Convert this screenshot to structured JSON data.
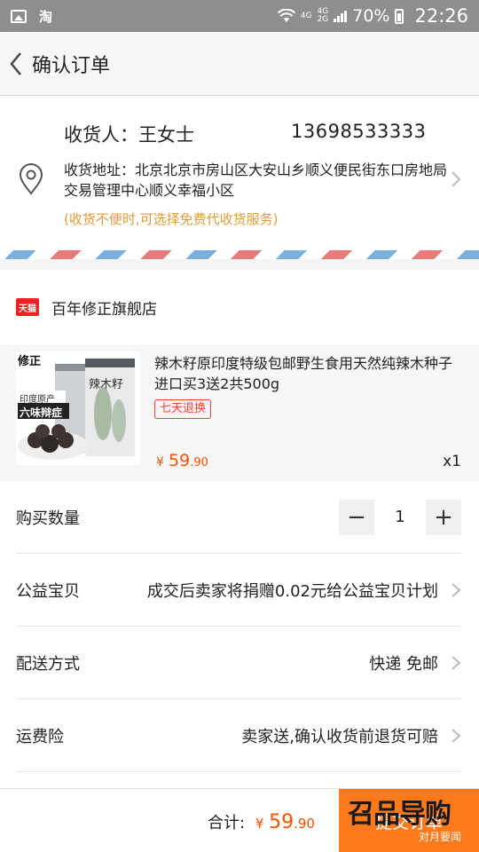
{
  "status_bar": {
    "app_indicator": "淘",
    "network_top": "4G",
    "network_bottom": "2G",
    "network_left": "4G",
    "battery": "70%",
    "time": "22:26"
  },
  "header": {
    "title": "确认订单"
  },
  "address": {
    "recipient": "收货人：王女士",
    "phone": "13698533333",
    "address": "收货地址：北京北京市房山区大安山乡顺义便民街东口房地局交易管理中心顺义幸福小区",
    "note": "(收货不便时,可选择免费代收货服务)"
  },
  "shop": {
    "badge": "天猫",
    "name": "百年修正旗舰店"
  },
  "item": {
    "title": "辣木籽原印度特级包邮野生食用天然纯辣木种子进口买3送2共500g",
    "tag": "七天退换",
    "price_currency": "¥",
    "price_int": "59",
    "price_dec": ".90",
    "quantity": "x1",
    "image_texts": {
      "brand": "修正",
      "banner": "六味辩症",
      "subtitle": "印度原产",
      "can_label": "辣木籽"
    }
  },
  "rows": {
    "quantity": {
      "label": "购买数量",
      "value": "1",
      "minus": "−",
      "plus": "+"
    },
    "charity": {
      "label": "公益宝贝",
      "value": "成交后卖家将捐赠0.02元给公益宝贝计划"
    },
    "delivery": {
      "label": "配送方式",
      "value": "快递 免邮"
    },
    "insurance": {
      "label": "运费险",
      "value": "卖家送,确认收货前退货可赔"
    }
  },
  "footer": {
    "total_label": "合计:",
    "total_currency": "¥",
    "total_int": "59",
    "total_dec": ".90",
    "submit_label": "提交订单"
  },
  "watermark": {
    "line1": "召品导购",
    "line2": "对月要闻"
  },
  "colors": {
    "accent": "#ff5000",
    "submit": "#ff7a1c",
    "note": "#e29b3c",
    "tmall": "#ee2222"
  }
}
